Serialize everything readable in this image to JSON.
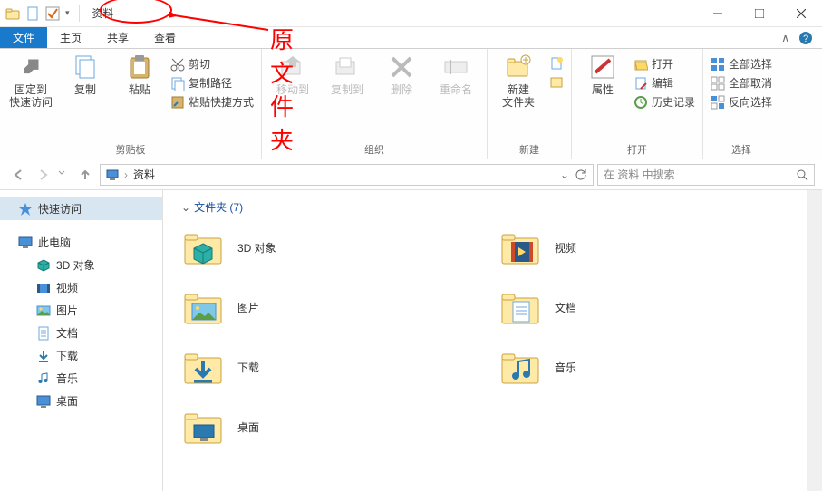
{
  "titlebar": {
    "title": "资料"
  },
  "annotation": {
    "text": "原文件夹"
  },
  "tabs": {
    "file": "文件",
    "home": "主页",
    "share": "共享",
    "view": "查看"
  },
  "ribbon": {
    "clipboard": {
      "pin": "固定到\n快速访问",
      "copy": "复制",
      "paste": "粘贴",
      "cut": "剪切",
      "copypath": "复制路径",
      "pasteshortcut": "粘贴快捷方式",
      "label": "剪贴板"
    },
    "organize": {
      "moveto": "移动到",
      "copyto": "复制到",
      "delete": "删除",
      "rename": "重命名",
      "label": "组织"
    },
    "new": {
      "newfolder": "新建\n文件夹",
      "label": "新建"
    },
    "open": {
      "properties": "属性",
      "open": "打开",
      "edit": "编辑",
      "history": "历史记录",
      "label": "打开"
    },
    "select": {
      "all": "全部选择",
      "none": "全部取消",
      "invert": "反向选择",
      "label": "选择"
    }
  },
  "address": {
    "path": "资料"
  },
  "search": {
    "placeholder": "在 资料 中搜索"
  },
  "tree": {
    "quickaccess": "快速访问",
    "thispc": "此电脑",
    "items": [
      {
        "label": "3D 对象"
      },
      {
        "label": "视频"
      },
      {
        "label": "图片"
      },
      {
        "label": "文档"
      },
      {
        "label": "下载"
      },
      {
        "label": "音乐"
      },
      {
        "label": "桌面"
      }
    ]
  },
  "section": {
    "header": "文件夹 (7)"
  },
  "folders": {
    "col1": [
      {
        "label": "3D 对象"
      },
      {
        "label": "图片"
      },
      {
        "label": "下载"
      },
      {
        "label": "桌面"
      }
    ],
    "col2": [
      {
        "label": "视频"
      },
      {
        "label": "文档"
      },
      {
        "label": "音乐"
      }
    ]
  }
}
